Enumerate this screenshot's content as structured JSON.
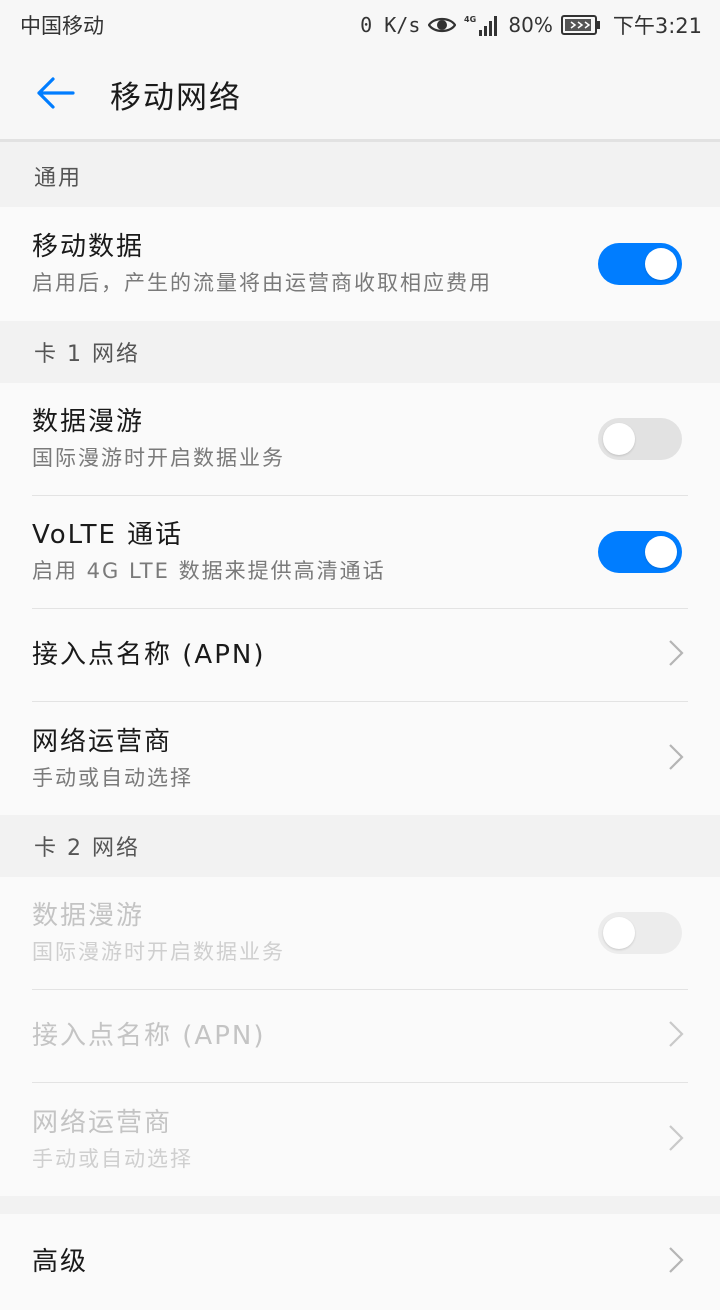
{
  "status_bar": {
    "carrier": "中国移动",
    "speed": "0 K/s",
    "network": "4G",
    "battery": "80%",
    "time": "下午3:21"
  },
  "app_bar": {
    "title": "移动网络"
  },
  "sections": {
    "general": {
      "header": "通用",
      "mobile_data": {
        "title": "移动数据",
        "subtitle": "启用后，产生的流量将由运营商收取相应费用",
        "enabled": true
      }
    },
    "sim1": {
      "header": "卡 1 网络",
      "roaming": {
        "title": "数据漫游",
        "subtitle": "国际漫游时开启数据业务",
        "enabled": false
      },
      "volte": {
        "title": "VoLTE 通话",
        "subtitle": "启用 4G LTE 数据来提供高清通话",
        "enabled": true
      },
      "apn": {
        "title": "接入点名称 (APN)"
      },
      "operator": {
        "title": "网络运营商",
        "subtitle": "手动或自动选择"
      }
    },
    "sim2": {
      "header": "卡 2 网络",
      "roaming": {
        "title": "数据漫游",
        "subtitle": "国际漫游时开启数据业务",
        "enabled": false
      },
      "apn": {
        "title": "接入点名称 (APN)"
      },
      "operator": {
        "title": "网络运营商",
        "subtitle": "手动或自动选择"
      }
    },
    "advanced": {
      "title": "高级"
    }
  },
  "colors": {
    "accent": "#007dff",
    "background": "#f2f2f2",
    "row_background": "#fafafa"
  },
  "icons": [
    "back-arrow-icon",
    "eye-icon",
    "signal-icon",
    "battery-icon",
    "chevron-right-icon"
  ]
}
